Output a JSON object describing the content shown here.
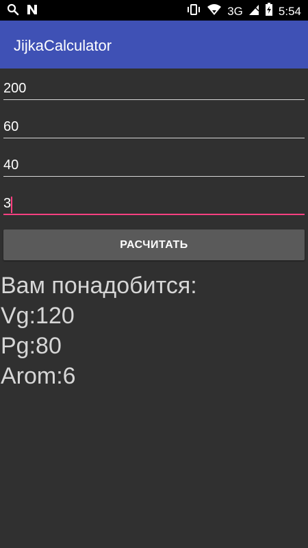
{
  "status_bar": {
    "network": "3G",
    "time": "5:54",
    "icons": [
      "search-icon",
      "n-icon",
      "vibrate-icon",
      "wifi-icon",
      "signal-icon",
      "battery-icon"
    ]
  },
  "app": {
    "title": "JijkaCalculator",
    "accent_color": "#ff4081",
    "primary_color": "#3f51b5"
  },
  "fields": [
    {
      "value": "200"
    },
    {
      "value": "60"
    },
    {
      "value": "40"
    },
    {
      "value": "3"
    }
  ],
  "button": {
    "label": "РАСЧИТАТЬ"
  },
  "result": {
    "heading": "Вам понадобится:",
    "lines": [
      "Vg:120",
      "Pg:80",
      "Arom:6"
    ]
  }
}
